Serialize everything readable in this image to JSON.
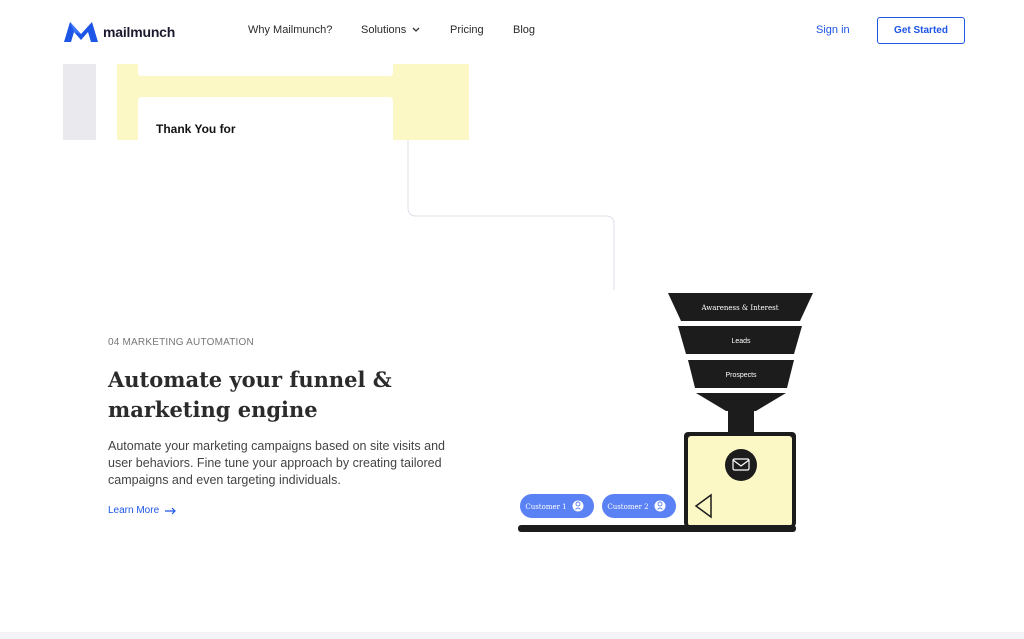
{
  "brand": {
    "name": "mailmunch",
    "accent": "#1d55e6"
  },
  "nav": {
    "why": "Why Mailmunch?",
    "solutions": "Solutions",
    "pricing": "Pricing",
    "blog": "Blog",
    "sign_in": "Sign in",
    "get_started": "Get Started"
  },
  "top_illustration": {
    "card_title": "Thank You for"
  },
  "section": {
    "eyebrow": "04 MARKETING AUTOMATION",
    "headline": "Automate your funnel & marketing engine",
    "description": "Automate your marketing campaigns based on site visits and user behaviors. Fine tune your approach by creating tailored campaigns and even targeting individuals.",
    "cta": "Learn More"
  },
  "funnel": {
    "stages": [
      "Awareness & Interest",
      "Leads",
      "Prospects"
    ],
    "customers": [
      "Customer 1",
      "Customer 2"
    ],
    "box_icon": "mail-icon",
    "colors": {
      "stage": "#1c1c1c",
      "box": "#fbf8c6",
      "pill": "#5b82f5"
    }
  }
}
